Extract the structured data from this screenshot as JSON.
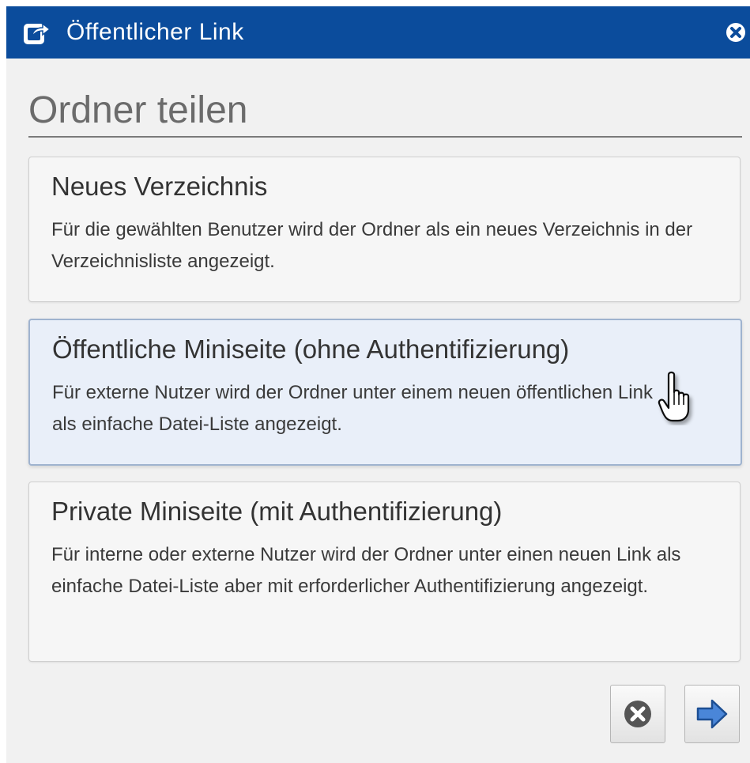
{
  "titlebar": {
    "title": "Öffentlicher Link",
    "icon": "share-icon",
    "close_icon": "close-icon",
    "color": "#0b4c9c"
  },
  "heading": "Ordner teilen",
  "options": [
    {
      "title": "Neues Verzeichnis",
      "description": "Für die gewählten Benutzer wird der Ordner als ein neues Verzeichnis in der Verzeichnisliste angezeigt."
    },
    {
      "title": "Öffentliche Miniseite (ohne Authentifizierung)",
      "description": "Für externe Nutzer wird der Ordner unter einem neuen öffentlichen Link als einfache Datei-Liste angezeigt.",
      "state": "hover"
    },
    {
      "title": "Private Miniseite (mit Authentifizierung)",
      "description": "Für interne oder externe Nutzer wird der Ordner unter einen neuen Link als einfache Datei-Liste aber mit erforderlicher Authentifizierung angezeigt."
    }
  ],
  "footer": {
    "cancel_icon": "cancel-icon",
    "next_icon": "arrow-right-icon"
  },
  "cursor_icon": "hand-pointer-icon"
}
